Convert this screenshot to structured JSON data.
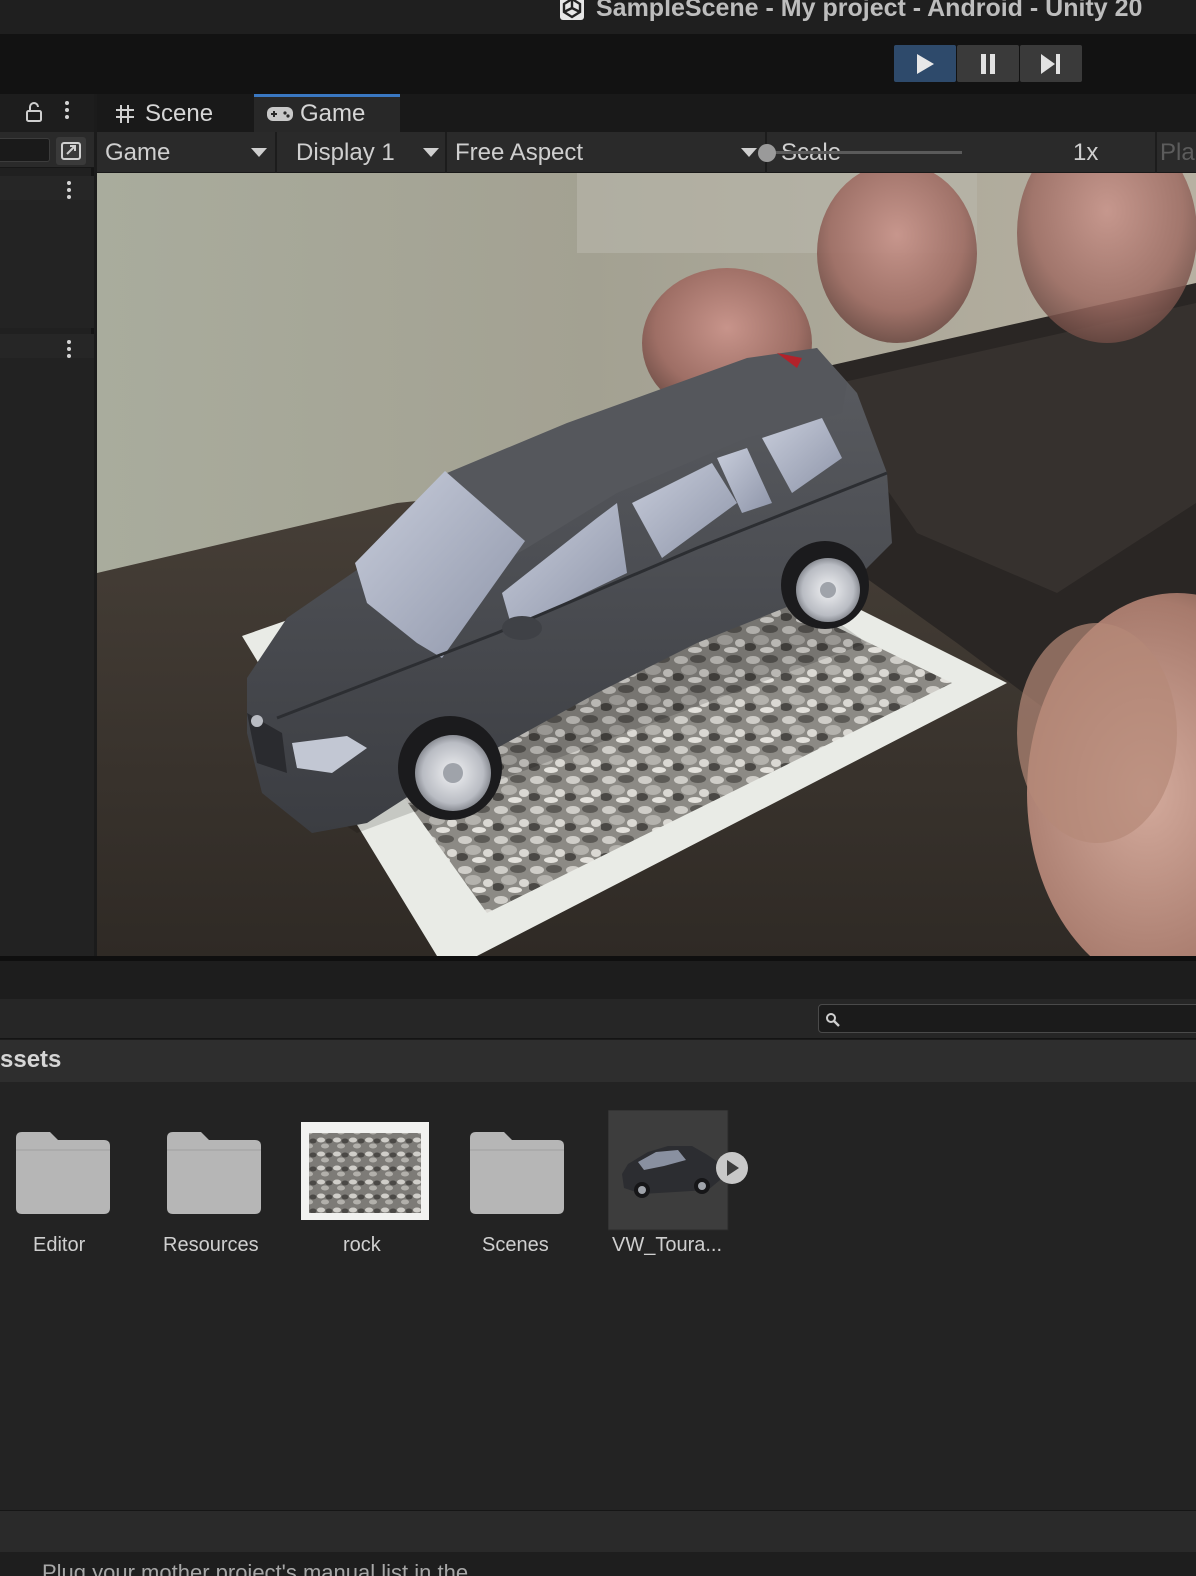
{
  "window": {
    "title": "SampleScene - My project - Android - Unity 20"
  },
  "toolbar": {
    "play": "play-icon",
    "pause": "pause-icon",
    "step": "step-icon",
    "accent": "#2e4a6b"
  },
  "tabs": [
    {
      "label": "Scene",
      "icon": "grid-hash-icon"
    },
    {
      "label": "Game",
      "icon": "gamepad-icon"
    }
  ],
  "gamebar": {
    "mode": "Game",
    "display": "Display 1",
    "aspect": "Free Aspect",
    "scale_label": "Scale",
    "scale_value": "1x",
    "play_label": "Pla"
  },
  "project": {
    "breadcrumb": "ssets",
    "search_placeholder": "",
    "assets": [
      {
        "name": "Editor",
        "type": "folder"
      },
      {
        "name": "Resources",
        "type": "folder"
      },
      {
        "name": "rock",
        "type": "texture"
      },
      {
        "name": "Scenes",
        "type": "folder"
      },
      {
        "name": "VW_Toura...",
        "type": "model"
      }
    ]
  },
  "status": {
    "text": "Plug your mother project's manual list in the"
  }
}
